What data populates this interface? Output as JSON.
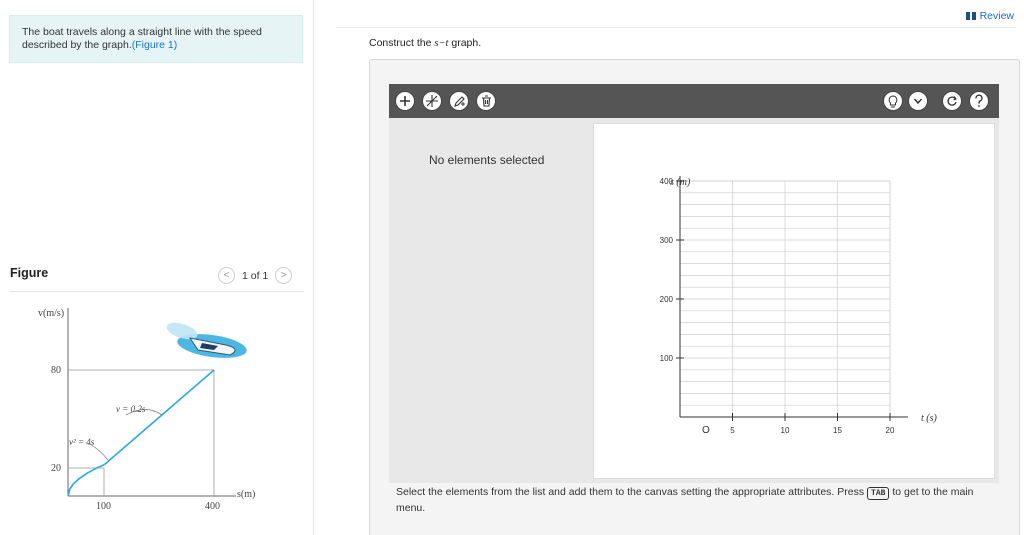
{
  "problem": {
    "text": "The boat travels along a straight line with the speed described by the graph.",
    "figure_link": "(Figure 1)"
  },
  "figure": {
    "heading": "Figure",
    "pager_text": "1 of 1",
    "chart_data": {
      "type": "line",
      "ylabel": "v(m/s)",
      "xlabel": "s(m)",
      "x_ticks": [
        "100",
        "400"
      ],
      "y_ticks": [
        "20",
        "80"
      ],
      "xlim": [
        0,
        440
      ],
      "ylim": [
        0,
        90
      ],
      "series": [
        {
          "equation": "v² = 4s",
          "x": [
            0,
            5,
            15,
            30,
            50,
            75,
            100
          ],
          "y": [
            0,
            4.47,
            7.75,
            10.95,
            14.14,
            17.32,
            20
          ]
        },
        {
          "equation": "v = 0.2s",
          "x": [
            100,
            400
          ],
          "y": [
            20,
            80
          ]
        }
      ],
      "colors": {
        "curve": "#29a8e0"
      }
    }
  },
  "header": {
    "review_label": "Review"
  },
  "question": {
    "prefix": "Construct the ",
    "var": "s−t",
    "suffix": " graph."
  },
  "tool": {
    "status": "No elements selected",
    "instructions_pre": "Select the elements from the list and add them to the canvas setting the appropriate attributes. Press ",
    "key": "TAB",
    "instructions_post": " to get to the main menu."
  },
  "canvas_graph": {
    "ylabel": "s (m)",
    "xlabel": "t (s)",
    "origin_label": "O",
    "y_ticks": [
      100,
      200,
      300,
      400
    ],
    "x_ticks": [
      5,
      10,
      15,
      20
    ],
    "xlim": [
      0,
      20
    ],
    "ylim": [
      0,
      400
    ]
  }
}
